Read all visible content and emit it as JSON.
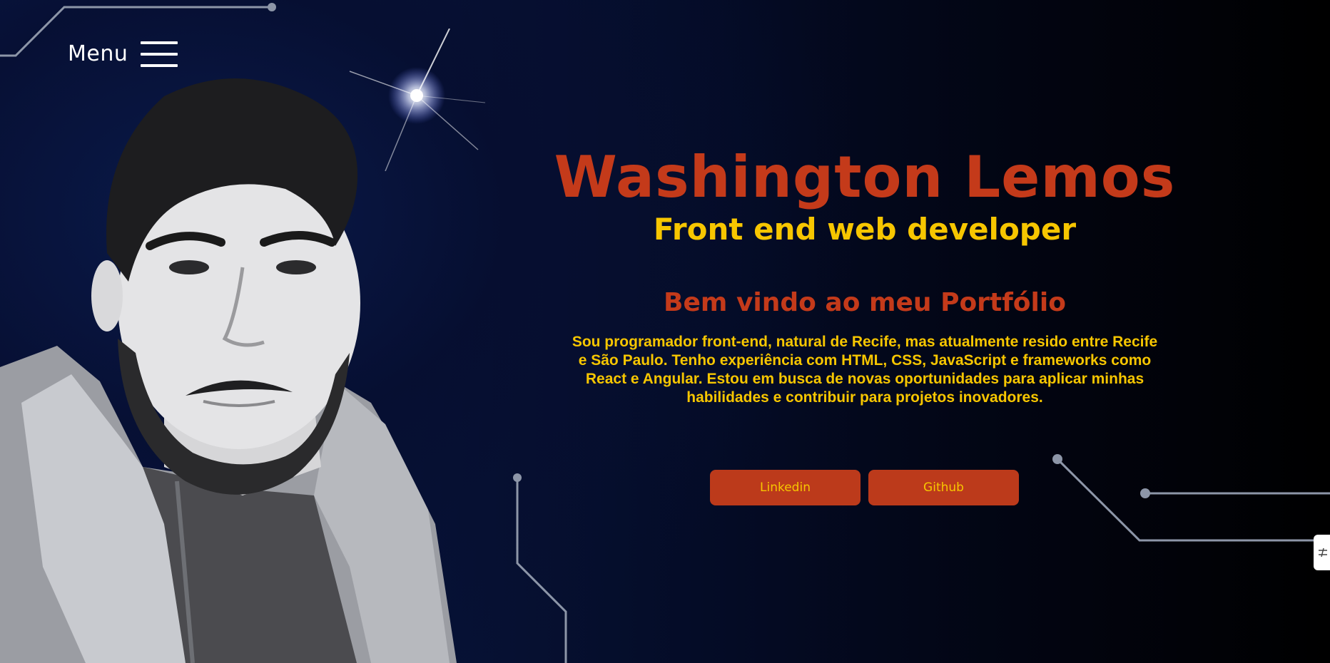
{
  "menu": {
    "label": "Menu",
    "icon": "hamburger-icon"
  },
  "hero": {
    "name": "Washington Lemos",
    "role": "Front end web developer",
    "welcome": "Bem vindo ao meu Portfólio",
    "bio": "Sou programador front-end, natural de Recife, mas atualmente resido entre Recife e São Paulo. Tenho experiência com HTML, CSS, JavaScript e frameworks como React e Angular. Estou em busca de novas oportunidades para aplicar minhas habilidades e contribuir para projetos inovadores."
  },
  "buttons": {
    "linkedin": "Linkedin",
    "github": "Github"
  },
  "side_tab": {
    "icon": "slider-toggle-icon"
  },
  "colors": {
    "accent_red": "#c43a1a",
    "accent_yellow": "#f7c600",
    "button_bg": "#bc3a1b",
    "background_navy": "#071338"
  }
}
